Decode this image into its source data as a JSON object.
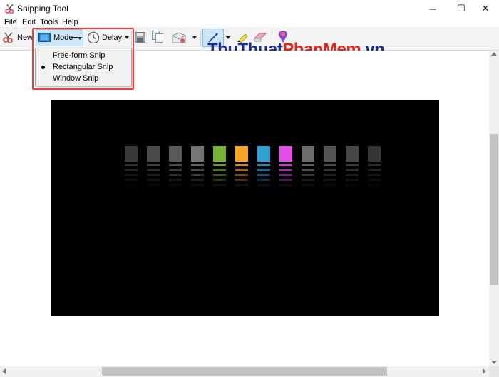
{
  "window": {
    "title": "Snipping Tool",
    "controls": {
      "minimize": "─",
      "maximize": "☐",
      "close": "✕"
    }
  },
  "menu": [
    "File",
    "Edit",
    "Tools",
    "Help"
  ],
  "toolbar": {
    "new_label": "New",
    "mode_label": "Mode",
    "delay_label": "Delay"
  },
  "mode_menu": {
    "options": [
      "Free-form Snip",
      "Rectangular Snip",
      "Window Snip"
    ],
    "selected": "Rectangular Snip"
  },
  "watermark": {
    "part1": "ThuThuat",
    "part2": "PhanMem",
    "part3": ".vn"
  },
  "snip_bars": {
    "count": 12,
    "colors": [
      "#3a3a3a",
      "#4a4a4a",
      "#5a5a5a",
      "#767676",
      "#7ab33a",
      "#f5a423",
      "#2fa0d8",
      "#e14fe6",
      "#6e6e6e",
      "#545454",
      "#464646",
      "#353535"
    ]
  },
  "colors": {
    "highlight": "#e2413c",
    "watermark_blue": "#1b2e8f",
    "watermark_red": "#e2251c"
  }
}
